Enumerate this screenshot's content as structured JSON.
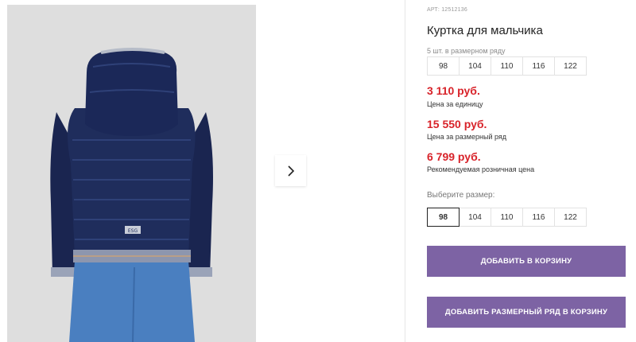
{
  "product": {
    "article": "АРТ: 12512136",
    "title": "Куртка для мальчика",
    "size_row_label": "5 шт. в размерном ряду",
    "size_row": [
      "98",
      "104",
      "110",
      "116",
      "122"
    ]
  },
  "prices": [
    {
      "amount": "3 110 руб.",
      "caption": "Цена за единицу"
    },
    {
      "amount": "15 550 руб.",
      "caption": "Цена за размерный ряд"
    },
    {
      "amount": "6 799 руб.",
      "caption": "Рекомендуемая розничная цена"
    }
  ],
  "size_select": {
    "label": "Выберите размер:",
    "options": [
      "98",
      "104",
      "110",
      "116",
      "122"
    ],
    "selected": "98"
  },
  "buttons": {
    "add_to_cart": "ДОБАВИТЬ В КОРЗИНУ",
    "add_size_row": "ДОБАВИТЬ РАЗМЕРНЫЙ РЯД В КОРЗИНУ"
  },
  "gallery": {
    "next_icon": "chevron-right-icon",
    "jacket_badge": "ESG"
  },
  "colors": {
    "price": "#d8232a",
    "button": "#7d63a4",
    "photo_bg": "#dedede",
    "jacket": "#1d2a57"
  }
}
